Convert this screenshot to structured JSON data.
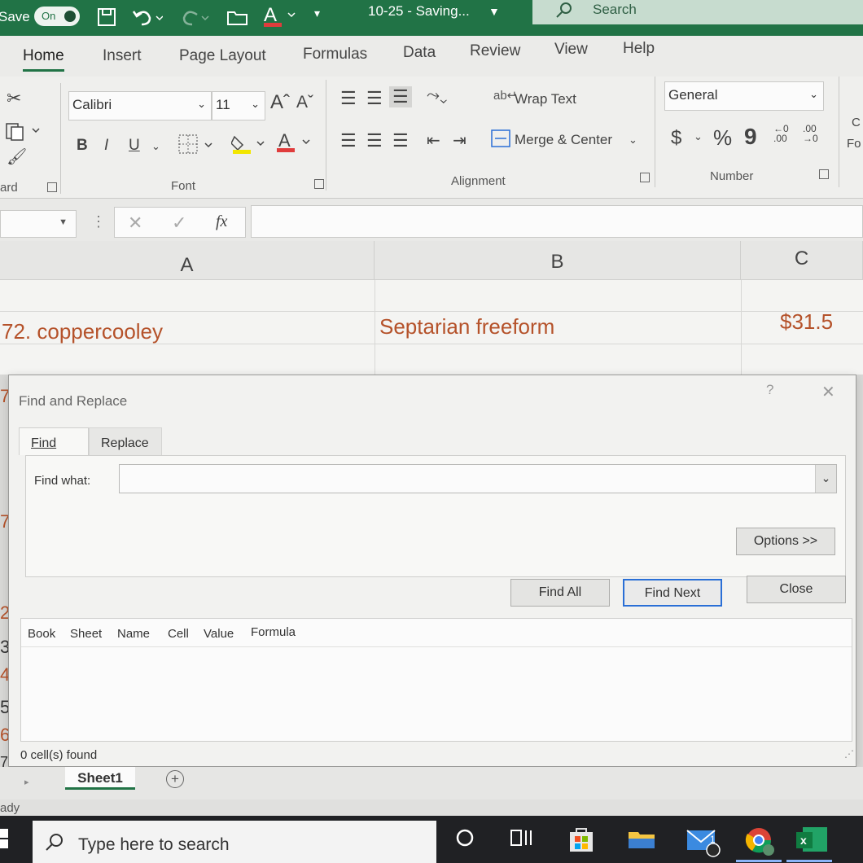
{
  "titlebar": {
    "autosave_label": "Save",
    "autosave_state": "On",
    "document_title": "10-25  -  Saving...",
    "search_label": "Search"
  },
  "tabs": [
    "Home",
    "Insert",
    "Page Layout",
    "Formulas",
    "Data",
    "Review",
    "View",
    "Help"
  ],
  "ribbon": {
    "font_name": "Calibri",
    "font_size": "11",
    "bold": "B",
    "italic": "I",
    "underline": "U",
    "wrap_text": "Wrap Text",
    "merge_center": "Merge & Center",
    "number_format": "General",
    "currency": "$",
    "percent": "%",
    "comma": "9",
    "group_clipboard": "ard",
    "group_font": "Font",
    "group_alignment": "Alignment",
    "group_number": "Number",
    "right_partial_top": "C",
    "right_partial_bottom": "Fo"
  },
  "formula_bar": {
    "fx": "fx"
  },
  "grid": {
    "col_a": "A",
    "col_b": "B",
    "col_c": "C",
    "cell_a": "72. coppercooley",
    "cell_b": "Septarian freeform",
    "cell_c": "$31.5"
  },
  "row_fragments": [
    "7",
    "7",
    "2 7",
    "3",
    "4 7",
    "5",
    "6 7",
    "7"
  ],
  "dialog": {
    "title": "Find and Replace",
    "help": "?",
    "close_x": "✕",
    "tab_find": "Find",
    "tab_replace": "Replace",
    "find_what_label": "Find what:",
    "find_what_value": "",
    "options_button": "Options >>",
    "find_all_button": "Find All",
    "find_next_button": "Find Next",
    "close_button": "Close",
    "result_columns": [
      "Book",
      "Sheet",
      "Name",
      "Cell",
      "Value",
      "Formula"
    ],
    "status": "0 cell(s) found"
  },
  "sheet_tab": "Sheet1",
  "add_sheet": "+",
  "status_text": "ady",
  "taskbar": {
    "search_placeholder": "Type here to search",
    "mail_badge": "1"
  }
}
